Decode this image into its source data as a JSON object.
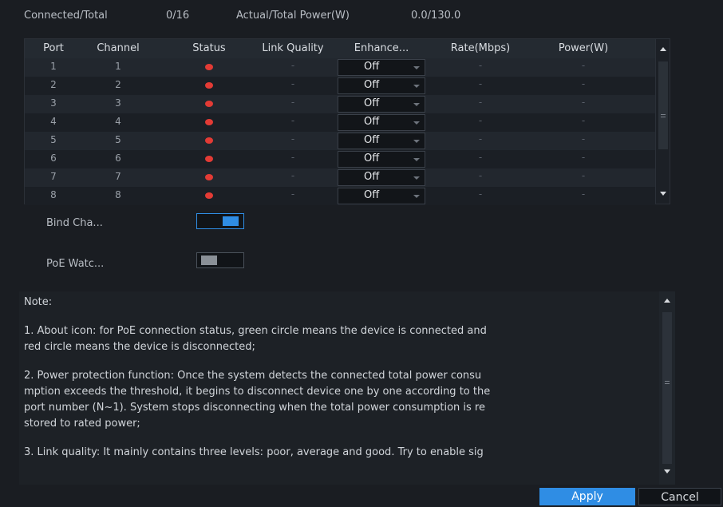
{
  "summary": {
    "connected_label": "Connected/Total",
    "connected_value": "0/16",
    "power_label": "Actual/Total Power(W)",
    "power_value": "0.0/130.0"
  },
  "table": {
    "headers": [
      "Port",
      "Channel",
      "Status",
      "Link Quality",
      "Enhance...",
      "Rate(Mbps)",
      "Power(W)"
    ],
    "rows": [
      {
        "port": "1",
        "channel": "1",
        "status": "disconnected",
        "link_quality": "-",
        "enhance": "Off",
        "rate": "-",
        "power": "-"
      },
      {
        "port": "2",
        "channel": "2",
        "status": "disconnected",
        "link_quality": "-",
        "enhance": "Off",
        "rate": "-",
        "power": "-"
      },
      {
        "port": "3",
        "channel": "3",
        "status": "disconnected",
        "link_quality": "-",
        "enhance": "Off",
        "rate": "-",
        "power": "-"
      },
      {
        "port": "4",
        "channel": "4",
        "status": "disconnected",
        "link_quality": "-",
        "enhance": "Off",
        "rate": "-",
        "power": "-"
      },
      {
        "port": "5",
        "channel": "5",
        "status": "disconnected",
        "link_quality": "-",
        "enhance": "Off",
        "rate": "-",
        "power": "-"
      },
      {
        "port": "6",
        "channel": "6",
        "status": "disconnected",
        "link_quality": "-",
        "enhance": "Off",
        "rate": "-",
        "power": "-"
      },
      {
        "port": "7",
        "channel": "7",
        "status": "disconnected",
        "link_quality": "-",
        "enhance": "Off",
        "rate": "-",
        "power": "-"
      },
      {
        "port": "8",
        "channel": "8",
        "status": "disconnected",
        "link_quality": "-",
        "enhance": "Off",
        "rate": "-",
        "power": "-"
      }
    ]
  },
  "options": {
    "bind_channel": {
      "label": "Bind Cha...",
      "state": "on"
    },
    "poe_watchdog": {
      "label": "PoE Watc...",
      "state": "off"
    }
  },
  "note": {
    "title": "Note:",
    "item1_line1": "1. About icon: for PoE connection status, green circle means the device is connected and",
    "item1_line2": " red circle means the device is disconnected;",
    "item2_line1": "2. Power protection function: Once the system detects the connected total power consu",
    "item2_line2": "mption exceeds the threshold, it begins to disconnect device one by one according to the",
    "item2_line3": " port number (N~1). System stops disconnecting when the total power consumption is re",
    "item2_line4": "stored to rated power;",
    "item3_line1": "3. Link quality: It mainly contains three levels: poor, average and good. Try to enable sig"
  },
  "buttons": {
    "apply": "Apply",
    "cancel": "Cancel"
  },
  "colors": {
    "accent": "#2f8de4",
    "status_disconnected": "#e33b35",
    "background": "#1a1d22"
  }
}
